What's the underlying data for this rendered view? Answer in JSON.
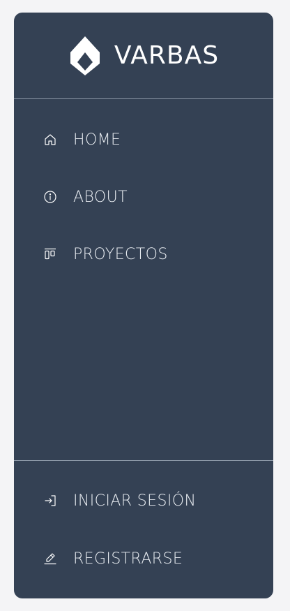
{
  "brand": {
    "name": "VARBAS",
    "logo_icon": "varbas-diamond-logo"
  },
  "nav": {
    "items": [
      {
        "label": "HOME",
        "icon": "home-icon"
      },
      {
        "label": "ABOUT",
        "icon": "info-circle-icon"
      },
      {
        "label": "PROYECTOS",
        "icon": "kanban-board-icon"
      }
    ]
  },
  "auth": {
    "items": [
      {
        "label": "INICIAR SESIÓN",
        "icon": "login-arrow-icon"
      },
      {
        "label": "REGISTRARSE",
        "icon": "pencil-icon"
      }
    ]
  },
  "colors": {
    "page_background": "#f4f4f6",
    "sidebar_background": "#344154",
    "divider": "#8e99a8",
    "text": "#e9edf2"
  }
}
